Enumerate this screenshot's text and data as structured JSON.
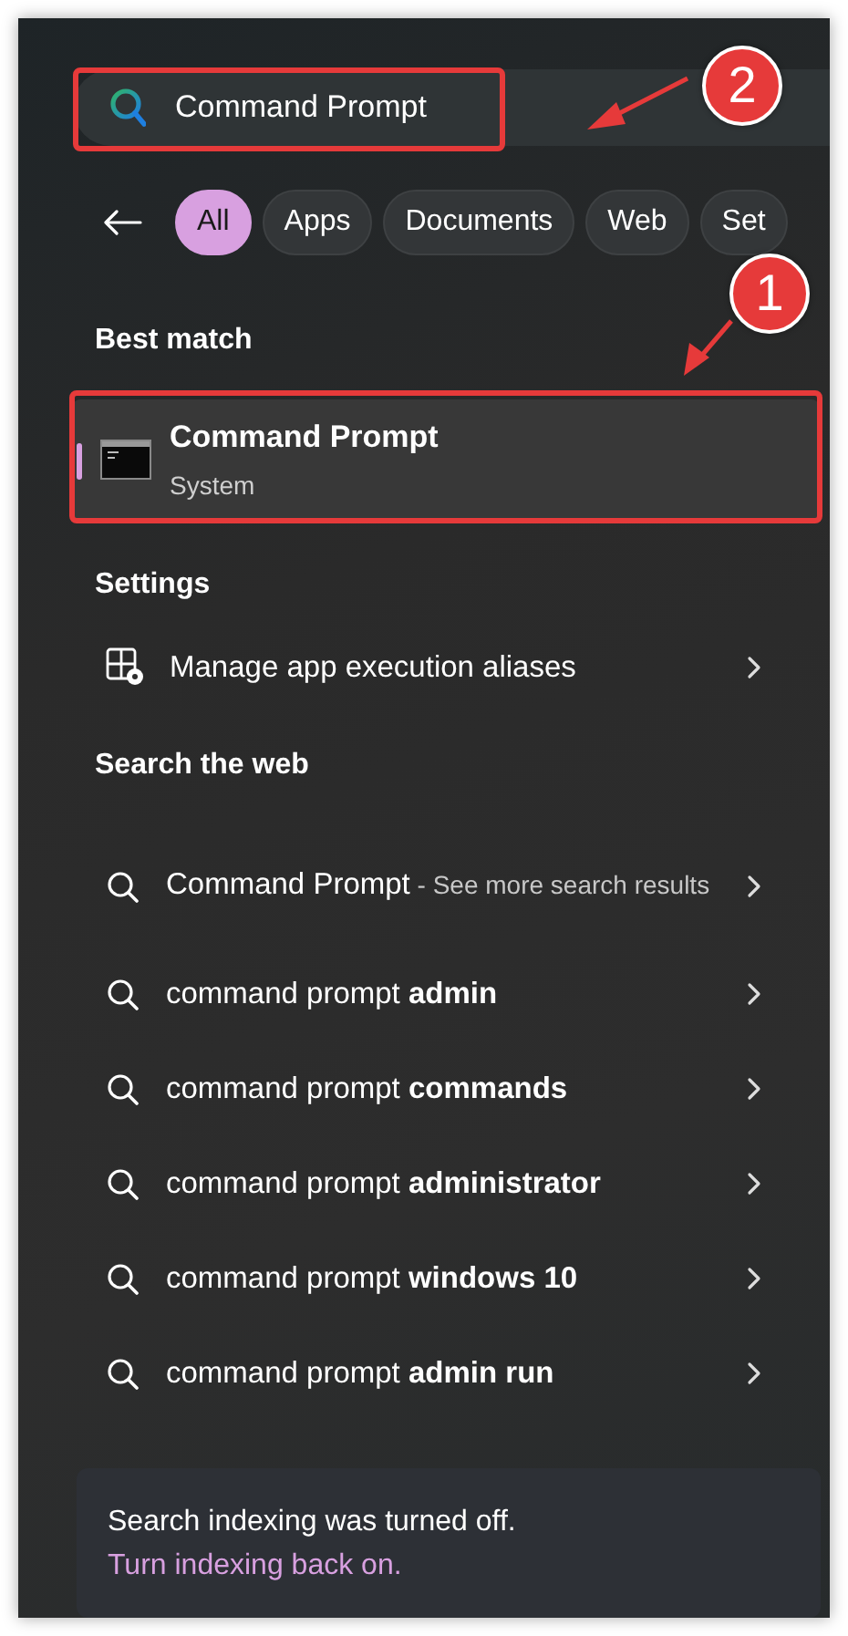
{
  "search": {
    "value": "Command Prompt"
  },
  "filters": [
    {
      "label": "All",
      "selected": true
    },
    {
      "label": "Apps",
      "selected": false
    },
    {
      "label": "Documents",
      "selected": false
    },
    {
      "label": "Web",
      "selected": false
    },
    {
      "label": "Set",
      "selected": false
    }
  ],
  "best_match": {
    "heading": "Best match",
    "title": "Command Prompt",
    "subtitle": "System",
    "selected": true
  },
  "settings": {
    "heading": "Settings",
    "items": [
      {
        "label": "Manage app execution aliases"
      }
    ]
  },
  "web": {
    "heading": "Search the web",
    "items": [
      {
        "text": "Command Prompt",
        "detail": "- See more search results"
      },
      {
        "text": "command prompt **admin**"
      },
      {
        "text": "command prompt **commands**"
      },
      {
        "text": "command prompt **administrator**"
      },
      {
        "text": "command prompt **windows 10**"
      },
      {
        "text": "command prompt **admin run**"
      }
    ]
  },
  "notice": {
    "message": "Search indexing was turned off.",
    "link": "Turn indexing back on."
  },
  "annotations": [
    {
      "number": "2"
    },
    {
      "number": "1"
    }
  ]
}
